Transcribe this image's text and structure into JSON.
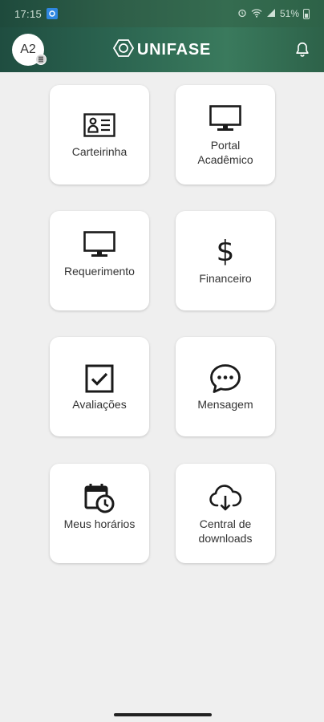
{
  "status_bar": {
    "time": "17:15",
    "battery_text": "51%",
    "icons": [
      "app-notification-icon",
      "alarm-icon",
      "wifi-icon",
      "signal-icon",
      "battery-icon"
    ]
  },
  "header": {
    "avatar_initials": "A2",
    "brand_name": "UNIFASE",
    "icons": [
      "brand-logo-icon",
      "bell-icon",
      "menu-icon"
    ]
  },
  "menu": {
    "carteirinha": {
      "label": "Carteirinha",
      "icon": "id-card-icon"
    },
    "portal": {
      "label": "Portal Acadêmico",
      "icon": "monitor-icon"
    },
    "requerimento": {
      "label": "Requerimento",
      "icon": "monitor-icon"
    },
    "financeiro": {
      "label": "Financeiro",
      "icon": "dollar-icon"
    },
    "avaliacoes": {
      "label": "Avaliações",
      "icon": "checkbox-icon"
    },
    "mensagem": {
      "label": "Mensagem",
      "icon": "chat-bubble-icon"
    },
    "horarios": {
      "label": "Meus horários",
      "icon": "calendar-clock-icon"
    },
    "downloads": {
      "label": "Central de downloads",
      "icon": "cloud-download-icon"
    }
  },
  "colors": {
    "header_start": "#1f4d40",
    "header_end": "#3a7a5d",
    "background": "#efefef",
    "card": "#ffffff",
    "icon": "#1a1a1a"
  }
}
